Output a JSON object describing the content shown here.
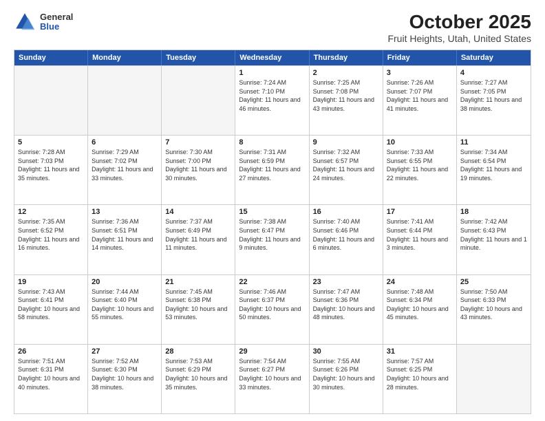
{
  "logo": {
    "general": "General",
    "blue": "Blue"
  },
  "title": "October 2025",
  "subtitle": "Fruit Heights, Utah, United States",
  "headers": [
    "Sunday",
    "Monday",
    "Tuesday",
    "Wednesday",
    "Thursday",
    "Friday",
    "Saturday"
  ],
  "rows": [
    [
      {
        "day": "",
        "info": "",
        "empty": true
      },
      {
        "day": "",
        "info": "",
        "empty": true
      },
      {
        "day": "",
        "info": "",
        "empty": true
      },
      {
        "day": "1",
        "info": "Sunrise: 7:24 AM\nSunset: 7:10 PM\nDaylight: 11 hours and 46 minutes.",
        "empty": false
      },
      {
        "day": "2",
        "info": "Sunrise: 7:25 AM\nSunset: 7:08 PM\nDaylight: 11 hours and 43 minutes.",
        "empty": false
      },
      {
        "day": "3",
        "info": "Sunrise: 7:26 AM\nSunset: 7:07 PM\nDaylight: 11 hours and 41 minutes.",
        "empty": false
      },
      {
        "day": "4",
        "info": "Sunrise: 7:27 AM\nSunset: 7:05 PM\nDaylight: 11 hours and 38 minutes.",
        "empty": false
      }
    ],
    [
      {
        "day": "5",
        "info": "Sunrise: 7:28 AM\nSunset: 7:03 PM\nDaylight: 11 hours and 35 minutes.",
        "empty": false
      },
      {
        "day": "6",
        "info": "Sunrise: 7:29 AM\nSunset: 7:02 PM\nDaylight: 11 hours and 33 minutes.",
        "empty": false
      },
      {
        "day": "7",
        "info": "Sunrise: 7:30 AM\nSunset: 7:00 PM\nDaylight: 11 hours and 30 minutes.",
        "empty": false
      },
      {
        "day": "8",
        "info": "Sunrise: 7:31 AM\nSunset: 6:59 PM\nDaylight: 11 hours and 27 minutes.",
        "empty": false
      },
      {
        "day": "9",
        "info": "Sunrise: 7:32 AM\nSunset: 6:57 PM\nDaylight: 11 hours and 24 minutes.",
        "empty": false
      },
      {
        "day": "10",
        "info": "Sunrise: 7:33 AM\nSunset: 6:55 PM\nDaylight: 11 hours and 22 minutes.",
        "empty": false
      },
      {
        "day": "11",
        "info": "Sunrise: 7:34 AM\nSunset: 6:54 PM\nDaylight: 11 hours and 19 minutes.",
        "empty": false
      }
    ],
    [
      {
        "day": "12",
        "info": "Sunrise: 7:35 AM\nSunset: 6:52 PM\nDaylight: 11 hours and 16 minutes.",
        "empty": false
      },
      {
        "day": "13",
        "info": "Sunrise: 7:36 AM\nSunset: 6:51 PM\nDaylight: 11 hours and 14 minutes.",
        "empty": false
      },
      {
        "day": "14",
        "info": "Sunrise: 7:37 AM\nSunset: 6:49 PM\nDaylight: 11 hours and 11 minutes.",
        "empty": false
      },
      {
        "day": "15",
        "info": "Sunrise: 7:38 AM\nSunset: 6:47 PM\nDaylight: 11 hours and 9 minutes.",
        "empty": false
      },
      {
        "day": "16",
        "info": "Sunrise: 7:40 AM\nSunset: 6:46 PM\nDaylight: 11 hours and 6 minutes.",
        "empty": false
      },
      {
        "day": "17",
        "info": "Sunrise: 7:41 AM\nSunset: 6:44 PM\nDaylight: 11 hours and 3 minutes.",
        "empty": false
      },
      {
        "day": "18",
        "info": "Sunrise: 7:42 AM\nSunset: 6:43 PM\nDaylight: 11 hours and 1 minute.",
        "empty": false
      }
    ],
    [
      {
        "day": "19",
        "info": "Sunrise: 7:43 AM\nSunset: 6:41 PM\nDaylight: 10 hours and 58 minutes.",
        "empty": false
      },
      {
        "day": "20",
        "info": "Sunrise: 7:44 AM\nSunset: 6:40 PM\nDaylight: 10 hours and 55 minutes.",
        "empty": false
      },
      {
        "day": "21",
        "info": "Sunrise: 7:45 AM\nSunset: 6:38 PM\nDaylight: 10 hours and 53 minutes.",
        "empty": false
      },
      {
        "day": "22",
        "info": "Sunrise: 7:46 AM\nSunset: 6:37 PM\nDaylight: 10 hours and 50 minutes.",
        "empty": false
      },
      {
        "day": "23",
        "info": "Sunrise: 7:47 AM\nSunset: 6:36 PM\nDaylight: 10 hours and 48 minutes.",
        "empty": false
      },
      {
        "day": "24",
        "info": "Sunrise: 7:48 AM\nSunset: 6:34 PM\nDaylight: 10 hours and 45 minutes.",
        "empty": false
      },
      {
        "day": "25",
        "info": "Sunrise: 7:50 AM\nSunset: 6:33 PM\nDaylight: 10 hours and 43 minutes.",
        "empty": false
      }
    ],
    [
      {
        "day": "26",
        "info": "Sunrise: 7:51 AM\nSunset: 6:31 PM\nDaylight: 10 hours and 40 minutes.",
        "empty": false
      },
      {
        "day": "27",
        "info": "Sunrise: 7:52 AM\nSunset: 6:30 PM\nDaylight: 10 hours and 38 minutes.",
        "empty": false
      },
      {
        "day": "28",
        "info": "Sunrise: 7:53 AM\nSunset: 6:29 PM\nDaylight: 10 hours and 35 minutes.",
        "empty": false
      },
      {
        "day": "29",
        "info": "Sunrise: 7:54 AM\nSunset: 6:27 PM\nDaylight: 10 hours and 33 minutes.",
        "empty": false
      },
      {
        "day": "30",
        "info": "Sunrise: 7:55 AM\nSunset: 6:26 PM\nDaylight: 10 hours and 30 minutes.",
        "empty": false
      },
      {
        "day": "31",
        "info": "Sunrise: 7:57 AM\nSunset: 6:25 PM\nDaylight: 10 hours and 28 minutes.",
        "empty": false
      },
      {
        "day": "",
        "info": "",
        "empty": true
      }
    ]
  ]
}
